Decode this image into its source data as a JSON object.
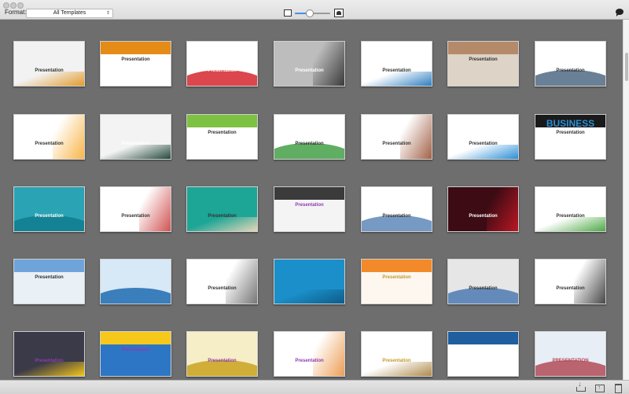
{
  "toolbar": {
    "format_label": "Format:",
    "format_selected": "All Templates",
    "zoom_level": 0.4
  },
  "scroll": {
    "position": 0.1
  },
  "tiles": [
    {
      "label": "Presentation",
      "bg": "#f2f2f2",
      "accent": "#e39b2c",
      "label_color": "#333"
    },
    {
      "label": "Presentation",
      "bg": "#ffffff",
      "accent": "#e58b17",
      "label_color": "#333"
    },
    {
      "label": "Presentation",
      "bg": "#ffffff",
      "accent": "#d6262e",
      "label_color": "#ffffff"
    },
    {
      "label": "Presentation",
      "bg": "#bdbdbd",
      "accent": "#1a1a1a",
      "label_color": "#ffffff"
    },
    {
      "label": "Presentation",
      "bg": "#ffffff",
      "accent": "#2f7fc1",
      "label_color": "#333"
    },
    {
      "label": "Presentation",
      "bg": "#ddd3c6",
      "accent": "#b58a6b",
      "label_color": "#333"
    },
    {
      "label": "Presentation",
      "bg": "#ffffff",
      "accent": "#4f6a84",
      "label_color": "#333"
    },
    {
      "label": "Presentation",
      "bg": "#ffffff",
      "accent": "#f7a31d",
      "label_color": "#333"
    },
    {
      "label": "Presentation",
      "bg": "#f3f3f3",
      "accent": "#244a3c",
      "label_color": "#ffffff"
    },
    {
      "label": "Presentation",
      "bg": "#ffffff",
      "accent": "#7dc242",
      "label_color": "#333"
    },
    {
      "label": "Presentation",
      "bg": "#ffffff",
      "accent": "#44a047",
      "label_color": "#333"
    },
    {
      "label": "Presentation",
      "bg": "#ffffff",
      "accent": "#8b3a1a",
      "label_color": "#333"
    },
    {
      "label": "Presentation",
      "bg": "#ffffff",
      "accent": "#2b8fd6",
      "label_color": "#333"
    },
    {
      "label": "Presentation",
      "bg": "#ffffff",
      "accent": "#1a1a1a",
      "label_color": "#333",
      "banner": "BUSINESS"
    },
    {
      "label": "Presentation",
      "bg": "#2aa3b5",
      "accent": "#0f7c8f",
      "label_color": "#ffffff"
    },
    {
      "label": "Presentation",
      "bg": "#ffffff",
      "accent": "#c62828",
      "label_color": "#333"
    },
    {
      "label": "Presentation",
      "bg": "#1da596",
      "accent": "#e6d7b8",
      "label_color": "#333"
    },
    {
      "label": "Presentation",
      "bg": "#f4f4f4",
      "accent": "#3b3b3b",
      "label_color": "#8e3bb2"
    },
    {
      "label": "Presentation",
      "bg": "#ffffff",
      "accent": "#5e88b8",
      "label_color": "#333"
    },
    {
      "label": "Presentation",
      "bg": "#3c0b14",
      "accent": "#d81b28",
      "label_color": "#ffffff"
    },
    {
      "label": "Presentation",
      "bg": "#ffffff",
      "accent": "#4da945",
      "label_color": "#333"
    },
    {
      "label": "Presentation",
      "bg": "#e9f0f6",
      "accent": "#6ea4d9",
      "label_color": "#333"
    },
    {
      "label": "",
      "bg": "#d7e8f6",
      "accent": "#1e6bb0",
      "label_color": "#333"
    },
    {
      "label": "Presentation",
      "bg": "#ffffff",
      "accent": "#555555",
      "label_color": "#333"
    },
    {
      "label": "",
      "bg": "#1b8fc9",
      "accent": "#0d5c88",
      "label_color": "#333"
    },
    {
      "label": "Presentation",
      "bg": "#fdf7ef",
      "accent": "#f28a2a",
      "label_color": "#c39a2a"
    },
    {
      "label": "Presentation",
      "bg": "#e6e6e6",
      "accent": "#4c79b0",
      "label_color": "#333"
    },
    {
      "label": "Presentation",
      "bg": "#ffffff",
      "accent": "#1a1a1a",
      "label_color": "#333"
    },
    {
      "label": "Presentation",
      "bg": "#3a3a48",
      "accent": "#f3c51a",
      "label_color": "#8e3bb2"
    },
    {
      "label": "Presentation",
      "bg": "#2d76c5",
      "accent": "#f6c81b",
      "label_color": "#8e3bb2"
    },
    {
      "label": "Presentation",
      "bg": "#f6eec7",
      "accent": "#c9a21e",
      "label_color": "#8e3bb2"
    },
    {
      "label": "Presentation",
      "bg": "#ffffff",
      "accent": "#e8852c",
      "label_color": "#8e3bb2"
    },
    {
      "label": "Presentation",
      "bg": "#ffffff",
      "accent": "#b08a4b",
      "label_color": "#c39a2a"
    },
    {
      "label": "",
      "bg": "#ffffff",
      "accent": "#1f5e9f",
      "label_color": "#333"
    },
    {
      "label": "PRESENTATION",
      "bg": "#e8eef6",
      "accent": "#b24b57",
      "label_color": "#b24b57"
    }
  ]
}
